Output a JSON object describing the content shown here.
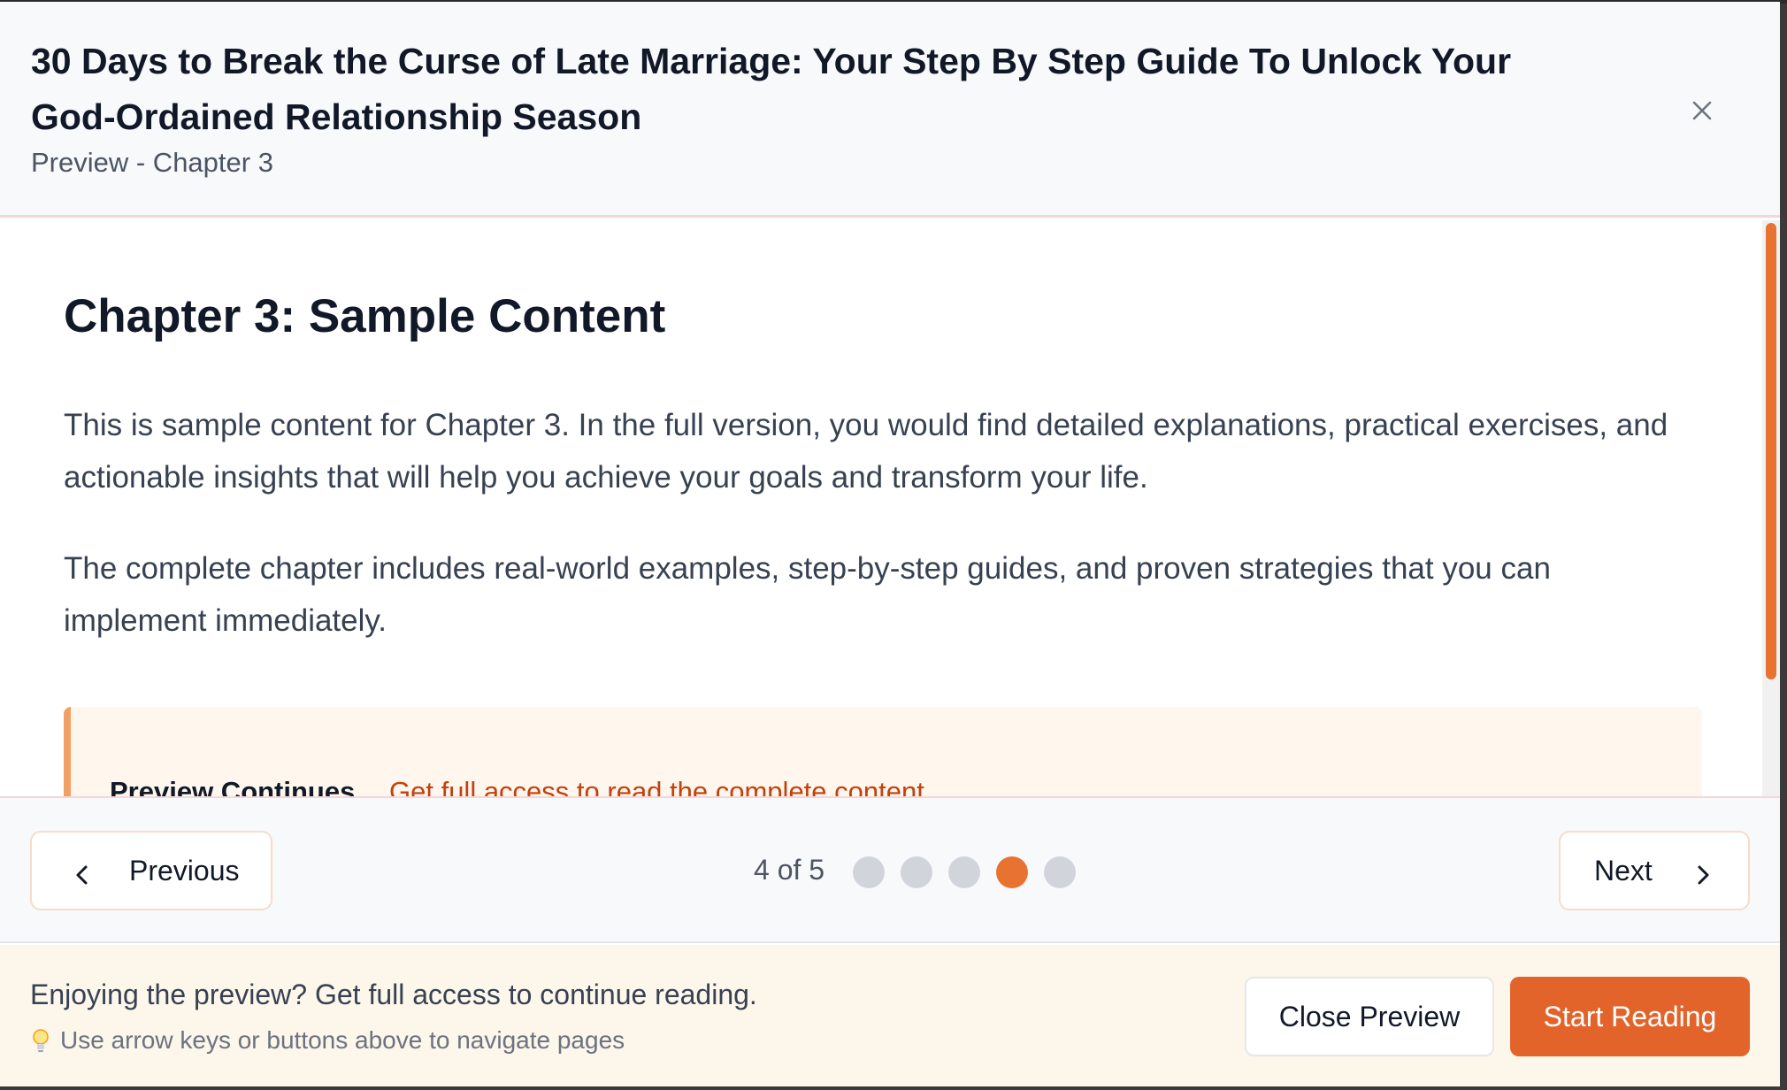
{
  "modal": {
    "title": "30 Days to Break the Curse of Late Marriage: Your Step By Step Guide To Unlock Your God-Ordained Relationship Season",
    "subtitle": "Preview - Chapter 3",
    "close_icon": "close-icon"
  },
  "content": {
    "heading": "Chapter 3: Sample Content",
    "paragraphs": [
      "This is sample content for Chapter 3. In the full version, you would find detailed explanations, practical exercises, and actionable insights that will help you achieve your goals and transform your life.",
      "The complete chapter includes real-world examples, step-by-step guides, and proven strategies that you can implement immediately."
    ],
    "callout": {
      "title": "Preview Continues...",
      "text": "Get full access to read the complete content"
    }
  },
  "navigation": {
    "previous_label": "Previous",
    "next_label": "Next",
    "page_indicator": "4 of 5",
    "current_page": 4,
    "total_pages": 5,
    "icons": {
      "previous": "chevron-left-icon",
      "next": "chevron-right-icon"
    }
  },
  "footer": {
    "message": "Enjoying the preview? Get full access to continue reading.",
    "tip": "Use arrow keys or buttons above to navigate pages",
    "tip_icon": "lightbulb-icon",
    "close_preview_label": "Close Preview",
    "start_reading_label": "Start Reading"
  },
  "colors": {
    "accent": "#e2642b",
    "active_dot": "#e8722f",
    "inactive_dot": "#d1d5db",
    "footer_bg": "#fdf6ea",
    "callout_bg": "#fff6ee"
  }
}
